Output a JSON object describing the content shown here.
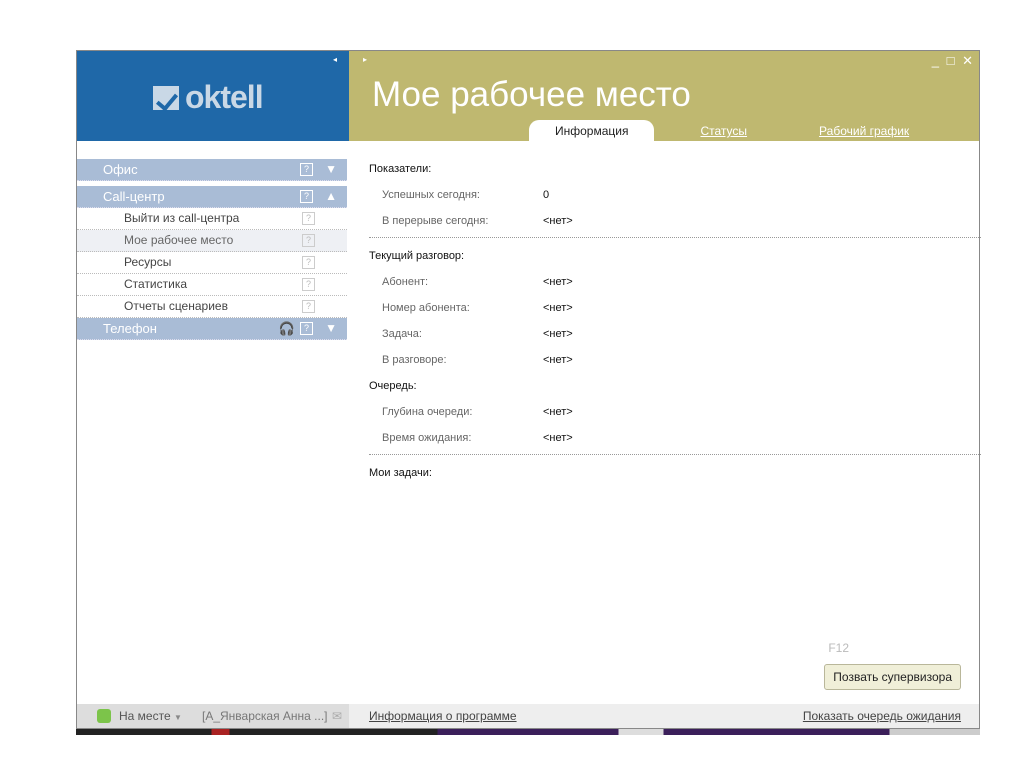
{
  "app": {
    "logo": "oktell",
    "title": "Мое рабочее место",
    "collapse": "◂",
    "expand": "▸",
    "window_controls": "_ □ ✕"
  },
  "tabs": [
    {
      "label": "Информация"
    },
    {
      "label": "Статусы"
    },
    {
      "label": "Рабочий график"
    }
  ],
  "sidebar": {
    "groups": [
      {
        "label": "Офис"
      },
      {
        "label": "Call-центр",
        "items": [
          "Выйти из call-центра",
          "Мое рабочее место",
          "Ресурсы",
          "Статистика",
          "Отчеты сценариев"
        ]
      },
      {
        "label": "Телефон"
      }
    ]
  },
  "content": {
    "s1": {
      "title": "Показатели:",
      "rows": [
        {
          "label": "Успешных сегодня:",
          "value": "0"
        },
        {
          "label": "В перерыве сегодня:",
          "value": "<нет>"
        }
      ]
    },
    "s2": {
      "title": "Текущий разговор:",
      "rows": [
        {
          "label": "Абонент:",
          "value": "<нет>"
        },
        {
          "label": "Номер абонента:",
          "value": "<нет>"
        },
        {
          "label": "Задача:",
          "value": "<нет>"
        },
        {
          "label": "В разговоре:",
          "value": "<нет>"
        }
      ]
    },
    "s3": {
      "title": "Очередь:",
      "rows": [
        {
          "label": "Глубина очереди:",
          "value": "<нет>"
        },
        {
          "label": "Время ожидания:",
          "value": "<нет>"
        }
      ]
    },
    "s4": {
      "title": "Мои задачи:"
    }
  },
  "hotkey": "F12",
  "supervisor_button": "Позвать супервизора",
  "footer": {
    "status": "На месте",
    "status_color": "#7cc44a",
    "user": "[А_Январская Анна ...]",
    "about": "Информация о программе",
    "queue": "Показать очередь ожидания"
  }
}
